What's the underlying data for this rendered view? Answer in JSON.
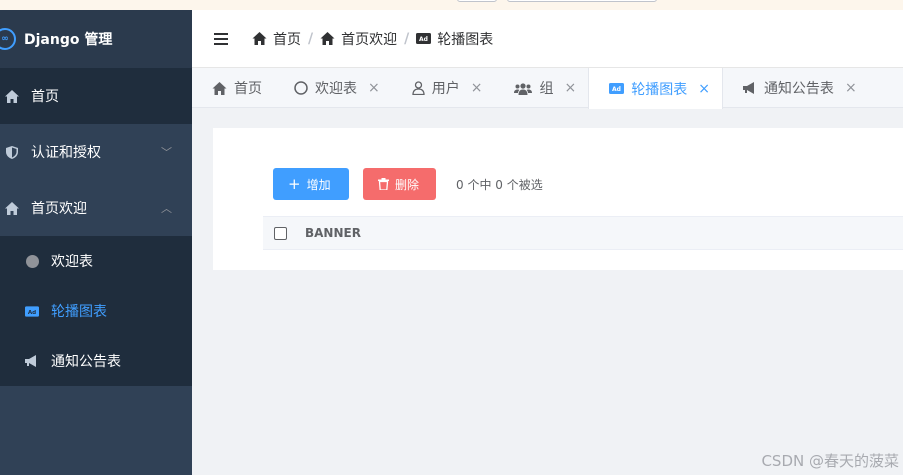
{
  "sidebar": {
    "logo_text": "Django 管理",
    "items": [
      {
        "label": "首页"
      },
      {
        "label": "认证和授权"
      },
      {
        "label": "首页欢迎"
      }
    ],
    "subitems": [
      {
        "label": "欢迎表"
      },
      {
        "label": "轮播图表"
      },
      {
        "label": "通知公告表"
      }
    ]
  },
  "breadcrumb": [
    "首页",
    "首页欢迎",
    "轮播图表"
  ],
  "tabs": [
    {
      "label": "首页"
    },
    {
      "label": "欢迎表"
    },
    {
      "label": "用户"
    },
    {
      "label": "组"
    },
    {
      "label": "轮播图表"
    },
    {
      "label": "通知公告表"
    }
  ],
  "toolbar": {
    "add_label": "增加",
    "delete_label": "删除",
    "selection_info": "0 个中 0 个被选"
  },
  "table": {
    "columns": [
      "BANNER"
    ]
  },
  "watermark": "CSDN @春天的菠菜",
  "colors": {
    "sidebar": "#304156",
    "sidebar_dark": "#1f2d3d",
    "accent": "#409eff",
    "danger": "#f56c6c"
  }
}
